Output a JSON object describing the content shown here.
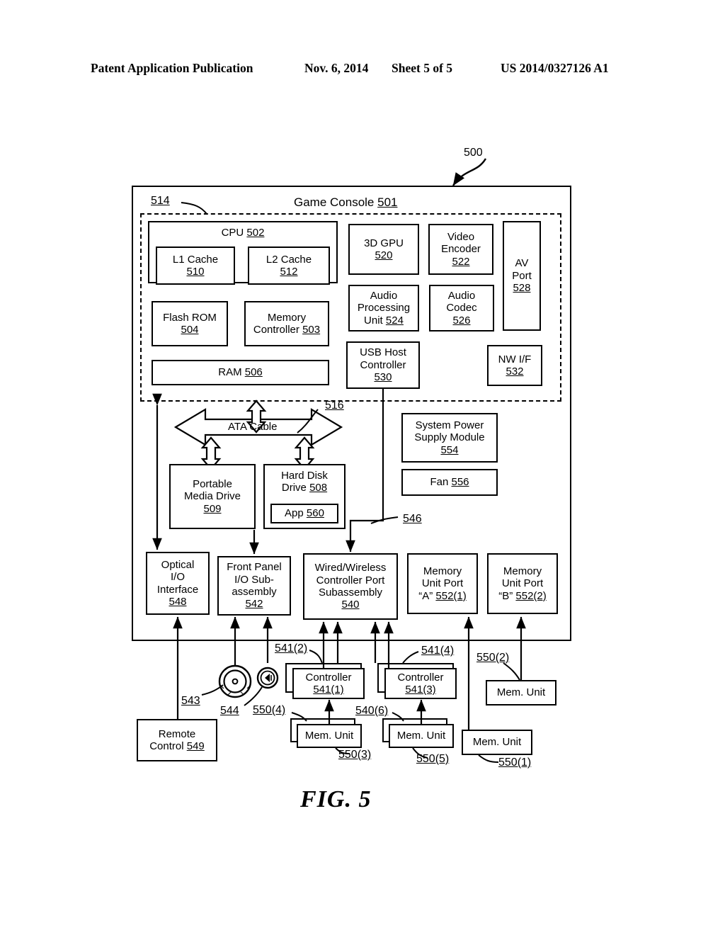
{
  "header": {
    "publication": "Patent Application Publication",
    "date": "Nov. 6, 2014",
    "sheet": "Sheet 5 of 5",
    "number": "US 2014/0327126 A1"
  },
  "figure": {
    "caption": "FIG.  5",
    "system_ref": "500"
  },
  "console": {
    "title_text": "Game Console ",
    "title_ref": "501",
    "module_ref": "514"
  },
  "blocks": {
    "cpu": {
      "l1": "CPU ",
      "r1": "502"
    },
    "l1_cache": {
      "l1": "L1 Cache",
      "r1": "510"
    },
    "l2_cache": {
      "l1": "L2 Cache",
      "r1": "512"
    },
    "flash_rom": {
      "l1": "Flash ROM",
      "r1": "504"
    },
    "mem_controller": {
      "l1": "Memory",
      "l2": "Controller ",
      "r1": "503"
    },
    "ram": {
      "l1": "RAM ",
      "r1": "506"
    },
    "gpu": {
      "l1": "3D GPU",
      "r1": "520"
    },
    "video_encoder": {
      "l1": "Video",
      "l2": "Encoder",
      "r1": "522"
    },
    "av_port": {
      "l1": "AV",
      "l2": "Port",
      "r1": "528"
    },
    "audio_proc": {
      "l1": "Audio",
      "l2": "Processing",
      "l3": "Unit ",
      "r1": "524"
    },
    "audio_codec": {
      "l1": "Audio",
      "l2": "Codec",
      "r1": "526"
    },
    "usb_host": {
      "l1": "USB Host",
      "l2": "Controller",
      "r1": "530"
    },
    "nw_if": {
      "l1": "NW I/F",
      "r1": "532"
    },
    "ata_cable": {
      "l1": "ATA Cable",
      "r1": "516"
    },
    "portable_media": {
      "l1": "Portable",
      "l2": "Media Drive",
      "r1": "509"
    },
    "hard_disk": {
      "l1": "Hard Disk",
      "l2": "Drive ",
      "r1": "508"
    },
    "app": {
      "l1": "App ",
      "r1": "560"
    },
    "power_supply": {
      "l1": "System Power",
      "l2": "Supply Module",
      "r1": "554"
    },
    "fan": {
      "l1": "Fan ",
      "r1": "556"
    },
    "optical_io": {
      "l1": "Optical",
      "l2": "I/O",
      "l3": "Interface",
      "r1": "548"
    },
    "front_panel": {
      "l1": "Front Panel",
      "l2": "I/O Sub-",
      "l3": "assembly",
      "r1": "542"
    },
    "controller_port": {
      "l1": "Wired/Wireless",
      "l2": "Controller Port",
      "l3": "Subassembly",
      "r1": "540"
    },
    "mem_port_a": {
      "l1": "Memory",
      "l2": "Unit Port",
      "l3": "“A” ",
      "r1": "552(1)"
    },
    "mem_port_b": {
      "l1": "Memory",
      "l2": "Unit Port",
      "l3": "“B” ",
      "r1": "552(2)"
    },
    "remote_control": {
      "l1": "Remote",
      "l2": "Control ",
      "r1": "549"
    },
    "controller_1": {
      "l1": "Controller",
      "r1": "541(1)"
    },
    "controller_3": {
      "l1": "Controller",
      "r1": "541(3)"
    },
    "mem_unit_3": {
      "l1": "Mem. Unit"
    },
    "mem_unit_5": {
      "l1": "Mem. Unit"
    },
    "mem_unit_2": {
      "l1": "Mem. Unit"
    },
    "mem_unit_1": {
      "l1": "Mem. Unit"
    }
  },
  "refs": {
    "r500": "500",
    "r514": "514",
    "r516": "516",
    "r546": "546",
    "r543": "543",
    "r544": "544",
    "r541_2": "541(2)",
    "r541_4": "541(4)",
    "r540_6": "540(6)",
    "r550_1": "550(1)",
    "r550_2": "550(2)",
    "r550_3": "550(3)",
    "r550_4": "550(4)",
    "r550_5": "550(5)"
  },
  "icons": {
    "media_remote_dial": "dial-icon",
    "ir_receiver": "ir-receiver-icon"
  },
  "colors": {
    "ink": "#000000",
    "paper": "#ffffff"
  }
}
